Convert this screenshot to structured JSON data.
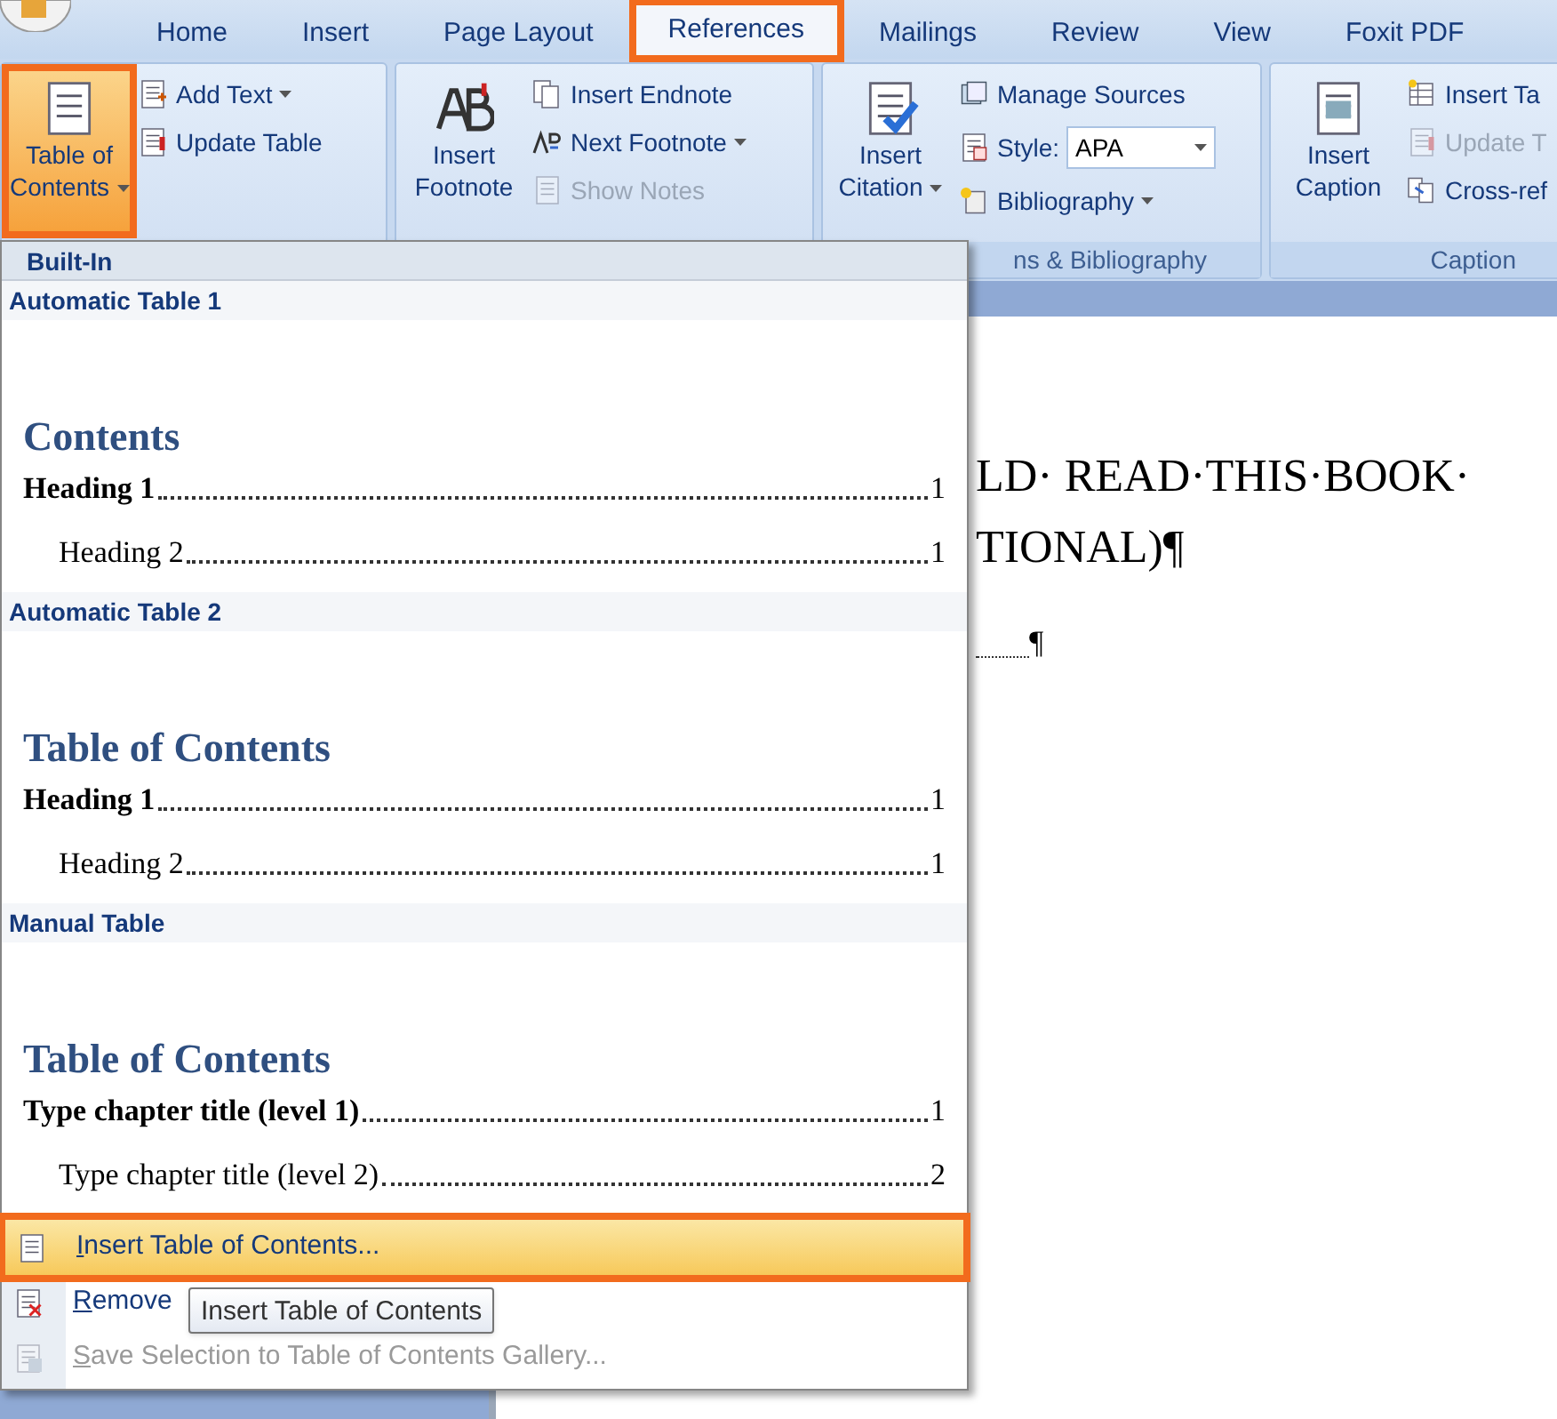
{
  "tabs": [
    {
      "label": "Home",
      "selected": false
    },
    {
      "label": "Insert",
      "selected": false
    },
    {
      "label": "Page Layout",
      "selected": false
    },
    {
      "label": "References",
      "selected": true
    },
    {
      "label": "Mailings",
      "selected": false
    },
    {
      "label": "Review",
      "selected": false
    },
    {
      "label": "View",
      "selected": false
    },
    {
      "label": "Foxit PDF",
      "selected": false
    }
  ],
  "groups": [
    {
      "big": {
        "label": "Table of Contents",
        "caret": true,
        "pressed": true
      },
      "small": [
        {
          "label": "Add Text",
          "caret": true,
          "disabled": false
        },
        {
          "label": "Update Table",
          "caret": false,
          "disabled": false
        }
      ]
    },
    {
      "big": {
        "label": "Insert Footnote",
        "caret": false,
        "pressed": false
      },
      "small": [
        {
          "label": "Insert Endnote",
          "caret": false,
          "disabled": false
        },
        {
          "label": "Next Footnote",
          "caret": true,
          "disabled": false
        },
        {
          "label": "Show Notes",
          "caret": false,
          "disabled": true
        }
      ]
    },
    {
      "label": "ns & Bibliography",
      "big": {
        "label": "Insert Citation",
        "caret": true,
        "pressed": false
      },
      "small": [
        {
          "label": "Manage Sources",
          "caret": false,
          "disabled": false
        },
        {
          "label": "Style:",
          "select": "APA",
          "caret": false,
          "disabled": false
        },
        {
          "label": "Bibliography",
          "caret": true,
          "disabled": false
        }
      ]
    },
    {
      "label": "Caption",
      "big": {
        "label": "Insert Caption",
        "caret": false,
        "pressed": false
      },
      "small": [
        {
          "label": "Insert Ta",
          "caret": false,
          "disabled": false
        },
        {
          "label": "Update T",
          "caret": false,
          "disabled": true
        },
        {
          "label": "Cross-ref",
          "caret": false,
          "disabled": false
        }
      ]
    }
  ],
  "menu": {
    "header": "Built-In",
    "galleries": [
      {
        "title": "Automatic Table 1",
        "heading": "Contents",
        "entries": [
          {
            "text": "Heading 1",
            "page": "1",
            "children": [
              {
                "text": "Heading 2",
                "page": "1"
              }
            ]
          }
        ]
      },
      {
        "title": "Automatic Table 2",
        "heading": "Table of Contents",
        "entries": [
          {
            "text": "Heading 1",
            "page": "1",
            "children": [
              {
                "text": "Heading 2",
                "page": "1"
              }
            ]
          }
        ]
      },
      {
        "title": "Manual Table",
        "heading": "Table of Contents",
        "entries": [
          {
            "text": "Type chapter title (level 1)",
            "page": "1",
            "bold": true,
            "children": [
              {
                "text": "Type chapter title (level 2)",
                "page": "2",
                "bold": false
              }
            ]
          }
        ]
      }
    ],
    "commands": [
      {
        "label": "Insert Table of Contents...",
        "highlighted": true,
        "disabled": false
      },
      {
        "label": "Remove",
        "highlighted": false,
        "disabled": false
      },
      {
        "label": "Save Selection to Table of Contents Gallery...",
        "highlighted": false,
        "disabled": true
      }
    ]
  },
  "tooltip": "Insert Table of Contents",
  "document": {
    "lines": [
      "LD· READ·THIS·BOOK·",
      "TIONAL)¶"
    ],
    "leader_end": "¶"
  }
}
